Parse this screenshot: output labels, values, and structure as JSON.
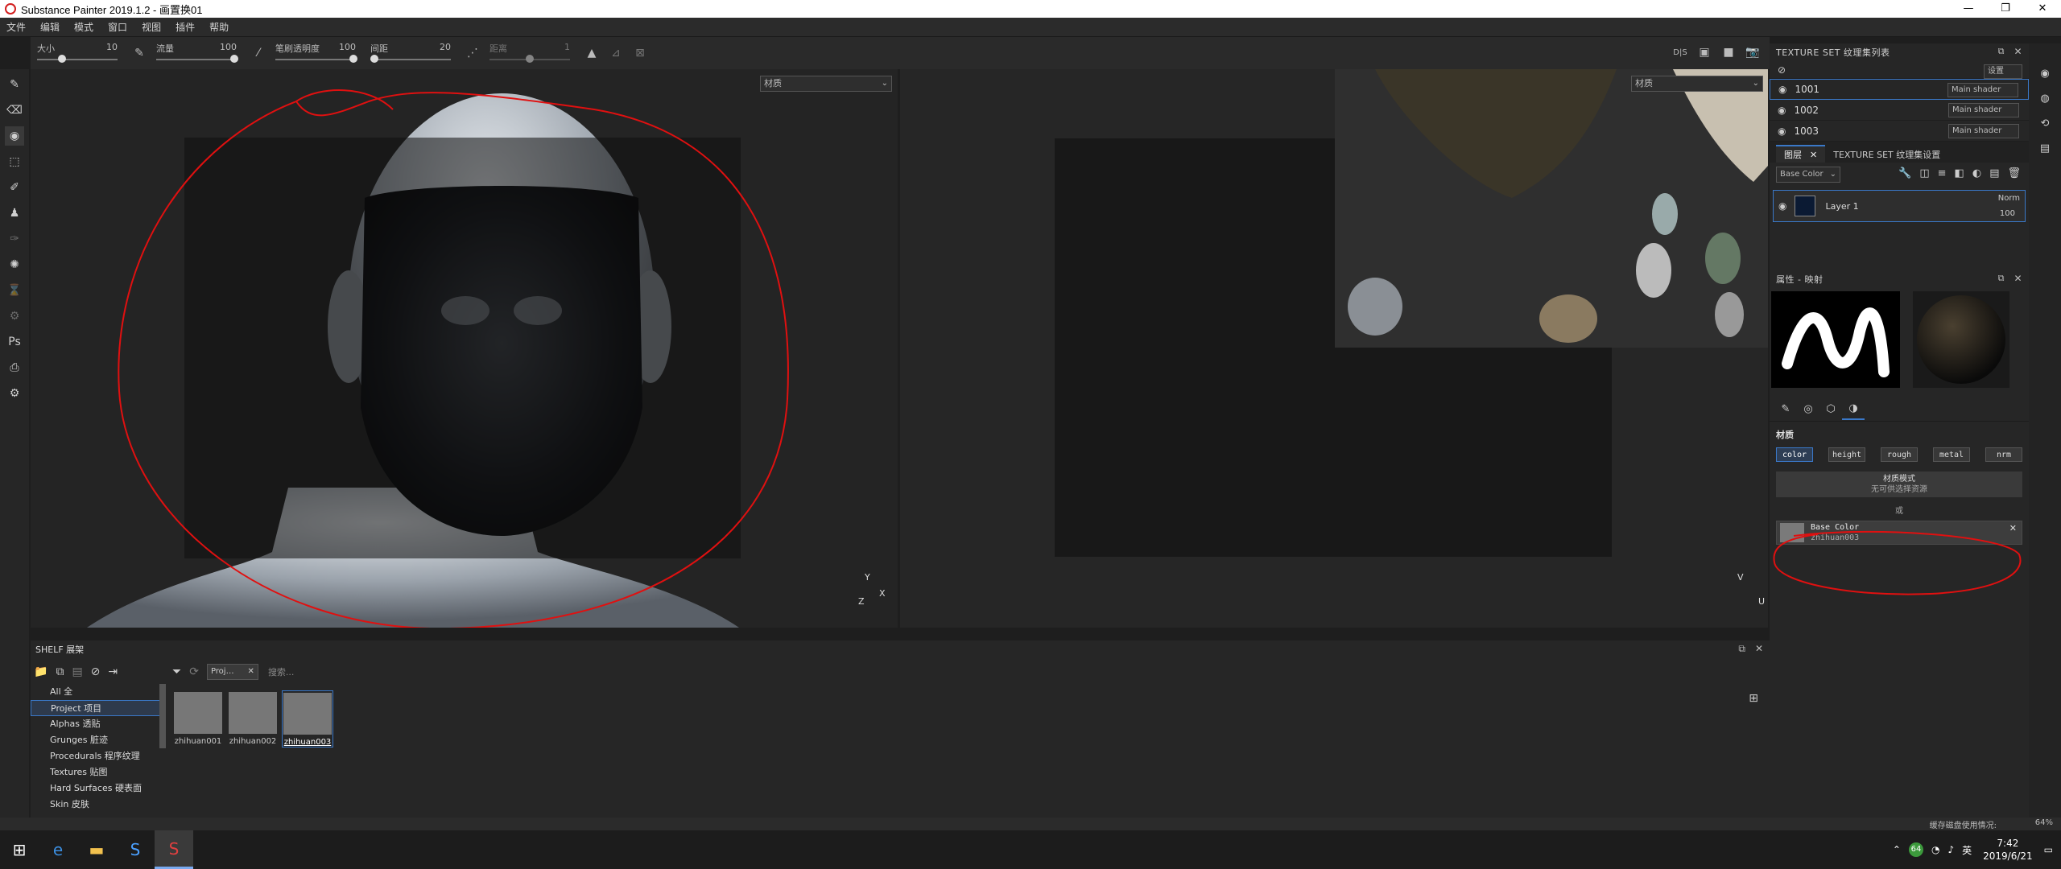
{
  "window": {
    "title": "Substance Painter 2019.1.2 - 画置换01",
    "min": "—",
    "max": "❐",
    "close": "✕"
  },
  "menu": [
    "文件",
    "编辑",
    "模式",
    "窗口",
    "视图",
    "插件",
    "帮助"
  ],
  "toolbar": {
    "size_label": "大小",
    "size_value": "10",
    "flow_label": "流量",
    "flow_value": "100",
    "opacity_label": "笔刷透明度",
    "opacity_value": "100",
    "spacing_label": "间距",
    "spacing_value": "20",
    "distance_label": "距离",
    "distance_value": "1",
    "top_right_icons": [
      "D|S",
      "▣",
      "■",
      "📷"
    ],
    "flow_fill": 1.0,
    "opacity_fill": 1.0,
    "spacing_fill": 0.2,
    "size_fill": 0.1
  },
  "viewport3d": {
    "dropdown": "材质",
    "axis_y": "Y",
    "axis_z": "Z",
    "axis_x": "X"
  },
  "viewportuv": {
    "dropdown": "材质",
    "axis_v": "V",
    "axis_u": "U"
  },
  "texture_set_list": {
    "title": "TEXTURE SET 纹理集列表",
    "settings": "设置",
    "rows": [
      {
        "name": "1001",
        "shader": "Main shader"
      },
      {
        "name": "1002",
        "shader": "Main shader"
      },
      {
        "name": "1003",
        "shader": "Main shader"
      }
    ]
  },
  "layers": {
    "tab_layers": "图层",
    "tab_settings": "TEXTURE SET 纹理集设置",
    "channel": "Base Color",
    "layer_name": "Layer 1",
    "blend": "Norm",
    "opacity": "100"
  },
  "properties": {
    "title": "属性 - 映射",
    "section": "材质",
    "channels": [
      "color",
      "height",
      "rough",
      "metal",
      "nrm"
    ],
    "mode_title": "材质模式",
    "mode_sub": "无可供选择资源",
    "or": "或",
    "slot_title": "Base Color",
    "slot_value": "zhihuan003"
  },
  "shelf": {
    "title": "SHELF 展架",
    "categories": [
      "All 全",
      "Project 项目",
      "Alphas 透贴",
      "Grunges 脏迹",
      "Procedurals 程序纹理",
      "Textures 贴图",
      "Hard Surfaces 硬表面",
      "Skin 皮肤"
    ],
    "filter_chip": "Proj…",
    "search_placeholder": "搜索...",
    "items": [
      "zhihuan001",
      "zhihuan002",
      "zhihuan003"
    ]
  },
  "status": {
    "cache": "缓存磁盘使用情况:",
    "percent": "64%"
  },
  "taskbar": {
    "time": "7:42",
    "date": "2019/6/21",
    "ime": "英",
    "battery": "64"
  },
  "colors": {
    "accent": "#3a78c8",
    "annotation": "#e01010"
  }
}
